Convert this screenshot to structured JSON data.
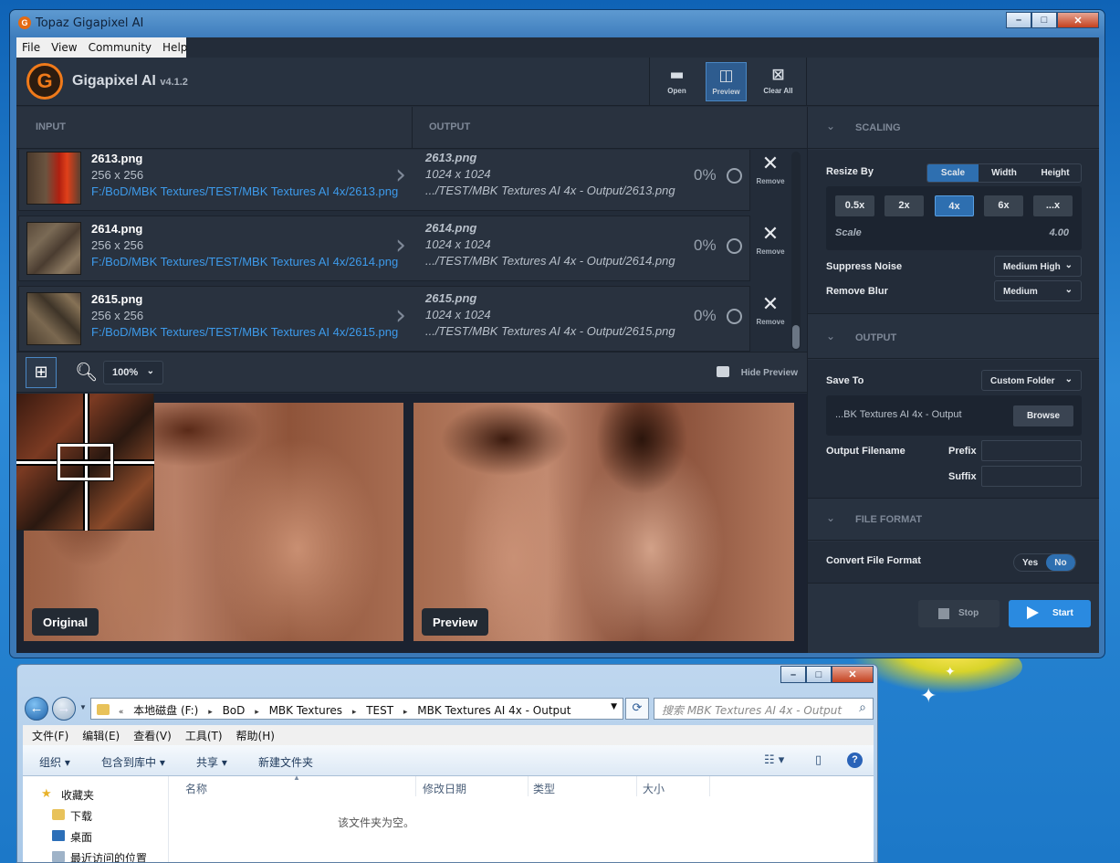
{
  "window": {
    "title": "Topaz Gigapixel AI"
  },
  "menu": [
    "File",
    "View",
    "Community",
    "Help"
  ],
  "brand": {
    "name": "Gigapixel AI",
    "version": "v4.1.2"
  },
  "toolbar": {
    "open": "Open",
    "preview": "Preview",
    "clear_all": "Clear All"
  },
  "columns": {
    "input": "INPUT",
    "output": "OUTPUT"
  },
  "files": [
    {
      "name": "2613.png",
      "dims": "256 x 256",
      "path": "F:/BoD/MBK Textures/TEST/MBK Textures AI 4x/2613.png",
      "out_name": "2613.png",
      "out_dims": "1024 x 1024",
      "out_path": ".../TEST/MBK Textures AI 4x - Output/2613.png",
      "progress": "0%",
      "remove": "Remove"
    },
    {
      "name": "2614.png",
      "dims": "256 x 256",
      "path": "F:/BoD/MBK Textures/TEST/MBK Textures AI 4x/2614.png",
      "out_name": "2614.png",
      "out_dims": "1024 x 1024",
      "out_path": ".../TEST/MBK Textures AI 4x - Output/2614.png",
      "progress": "0%",
      "remove": "Remove"
    },
    {
      "name": "2615.png",
      "dims": "256 x 256",
      "path": "F:/BoD/MBK Textures/TEST/MBK Textures AI 4x/2615.png",
      "out_name": "2615.png",
      "out_dims": "1024 x 1024",
      "out_path": ".../TEST/MBK Textures AI 4x - Output/2615.png",
      "progress": "0%",
      "remove": "Remove"
    }
  ],
  "viewbar": {
    "zoom": "100%",
    "hide_preview": "Hide Preview"
  },
  "preview": {
    "original_label": "Original",
    "preview_label": "Preview"
  },
  "scaling": {
    "header": "SCALING",
    "resize_by_label": "Resize By",
    "resize_options": [
      "Scale",
      "Width",
      "Height"
    ],
    "resize_selected": "Scale",
    "scale_buttons": [
      "0.5x",
      "2x",
      "4x",
      "6x",
      "...x"
    ],
    "scale_selected": "4x",
    "scale_label": "Scale",
    "scale_value": "4.00",
    "suppress_noise_label": "Suppress Noise",
    "suppress_noise_value": "Medium High",
    "remove_blur_label": "Remove Blur",
    "remove_blur_value": "Medium"
  },
  "output": {
    "header": "OUTPUT",
    "save_to_label": "Save To",
    "save_to_value": "Custom Folder",
    "folder_path": "...BK Textures AI 4x - Output",
    "browse": "Browse",
    "filename_label": "Output Filename",
    "prefix_label": "Prefix",
    "suffix_label": "Suffix"
  },
  "file_format": {
    "header": "FILE FORMAT",
    "convert_label": "Convert File Format",
    "yes": "Yes",
    "no": "No",
    "selected": "No"
  },
  "actions": {
    "stop": "Stop",
    "start": "Start"
  },
  "explorer": {
    "breadcrumbs": [
      "本地磁盘 (F:)",
      "BoD",
      "MBK Textures",
      "TEST",
      "MBK Textures AI 4x - Output"
    ],
    "search_placeholder": "搜索 MBK Textures AI 4x - Output",
    "menu": [
      "文件(F)",
      "编辑(E)",
      "查看(V)",
      "工具(T)",
      "帮助(H)"
    ],
    "commands": {
      "organize": "组织 ▾",
      "include_library": "包含到库中 ▾",
      "share": "共享 ▾",
      "new_folder": "新建文件夹"
    },
    "tree": [
      "收藏夹",
      "下载",
      "桌面",
      "最近访问的位置"
    ],
    "columns": [
      "名称",
      "修改日期",
      "类型",
      "大小"
    ],
    "empty_message": "该文件夹为空。"
  },
  "colors": {
    "accent": "#2e6fb0",
    "start": "#2a8ae0",
    "link": "#3d9aea",
    "brand_orange": "#f07a1a"
  }
}
